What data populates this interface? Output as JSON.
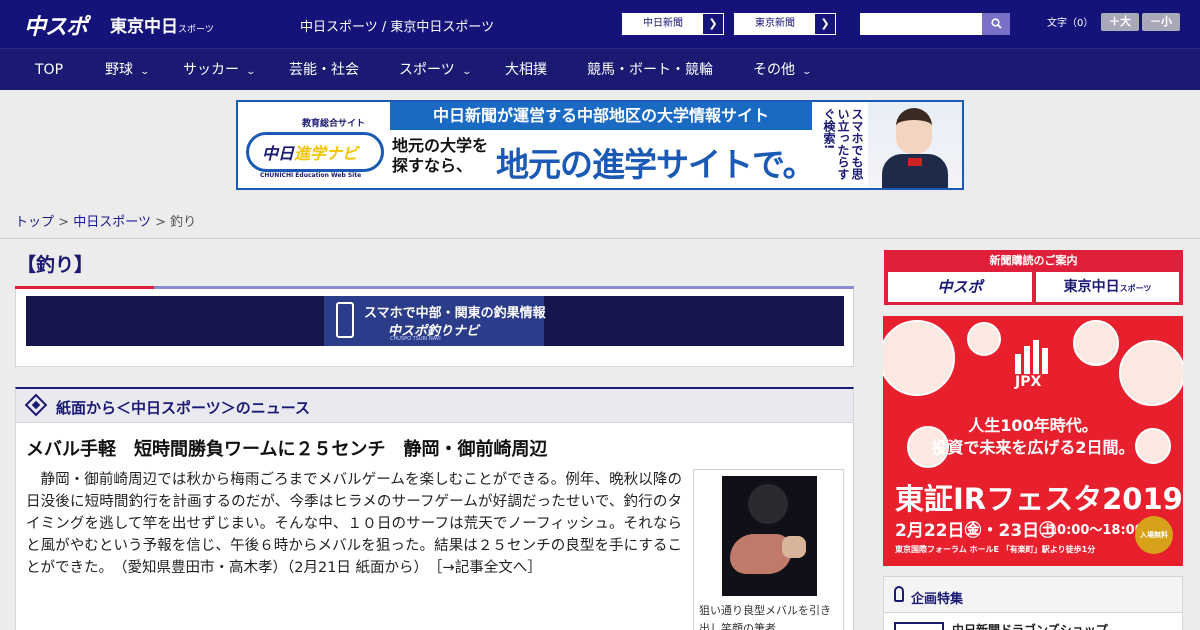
{
  "header": {
    "logo_chuspo": "中スポ",
    "logo_tokyo": "東京中日",
    "logo_tokyo_small": "スポーツ",
    "site_name": "中日スポーツ / 東京中日スポーツ",
    "external_links": [
      {
        "label": "中日新聞"
      },
      {
        "label": "東京新聞"
      }
    ],
    "search_placeholder": "",
    "font_size_label": "文字（0）",
    "font_larger": "＋大",
    "font_smaller": "－小"
  },
  "nav": {
    "items": [
      {
        "label": "TOP",
        "has_dropdown": false
      },
      {
        "label": "野球",
        "has_dropdown": true
      },
      {
        "label": "サッカー",
        "has_dropdown": true
      },
      {
        "label": "芸能・社会",
        "has_dropdown": false
      },
      {
        "label": "スポーツ",
        "has_dropdown": true
      },
      {
        "label": "大相撲",
        "has_dropdown": false
      },
      {
        "label": "競馬・ボート・競輪",
        "has_dropdown": false
      },
      {
        "label": "その他",
        "has_dropdown": true
      }
    ]
  },
  "banner": {
    "logo_small": "教育総合サイト",
    "logo_main_a": "中日",
    "logo_main_b": "進学ナビ",
    "logo_sub": "CHUNICHI Education Web Site",
    "headline": "中日新聞が運営する中部地区の大学情報サイト",
    "left_text_1": "地元の大学を",
    "left_text_2": "探すなら、",
    "big_text": "地元の進学サイトで。",
    "vertical_text": "スマホでも思い立ったらすぐ検索!"
  },
  "breadcrumb": {
    "items": [
      "トップ",
      "中日スポーツ",
      "釣り"
    ],
    "separator": ">"
  },
  "page": {
    "title": "【釣り】"
  },
  "tsuri_banner": {
    "line1": "スマホで中部・関東の釣果情報",
    "line2": "中スポ釣りナビ",
    "line3": "CHUSPO TSURI NAVI"
  },
  "news": {
    "section_title": "紙面から＜中日スポーツ＞のニュース",
    "article_title": "メバル手軽　短時間勝負ワームに２５センチ　静岡・御前崎周辺",
    "article_body": "静岡・御前崎周辺では秋から梅雨ごろまでメバルゲームを楽しむことができる。例年、晩秋以降の日没後に短時間釣行を計画するのだが、今季はヒラメのサーフゲームが好調だったせいで、釣行のタイミングを逃して竿を出せずじまい。そんな中、１０日のサーフは荒天でノーフィッシュ。それならと風がやむという予報を信じ、午後６時からメバルを狙った。結果は２５センチの良型を手にすることができた。　（愛知県豊田市・高木孝）（2月21日 紙面から）",
    "read_more": "［→記事全文へ］",
    "photo_caption": "狙い通り良型メバルを引き出し笑顔の筆者"
  },
  "sidebar": {
    "subscribe_head": "新聞購読のご案内",
    "subscribe_buttons": [
      "中スポ",
      "東京中日"
    ],
    "subscribe_small": "スポーツ",
    "ad": {
      "brand": "JPX",
      "line1": "人生100年時代。",
      "line2": "投資で未来を広げる2日間。",
      "title": "東証IRフェスタ2019",
      "date": "2月22日㊎・23日㊏",
      "time": "10:00～18:00",
      "venue": "東京国際フォーラム ホールE 「有楽町」駅より徒歩1分",
      "free": "入場無料"
    },
    "kikaku_title": "企画特集",
    "kikaku_item": "中日新聞ドラゴンズショップ"
  },
  "colors": {
    "header_bg": "#13137a",
    "nav_bg": "#1a1a73",
    "accent_red": "#e0203a",
    "link": "#1a1a90"
  }
}
